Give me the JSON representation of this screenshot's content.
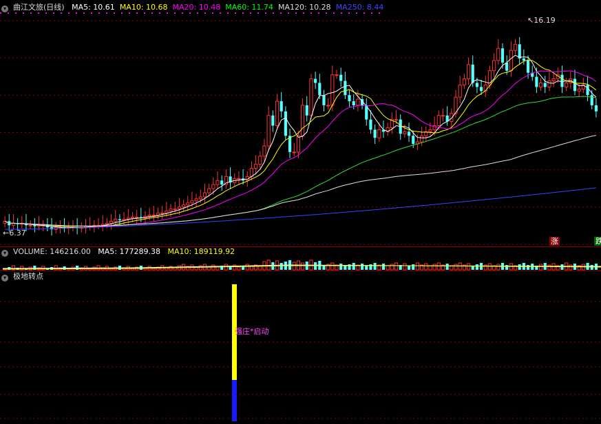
{
  "main": {
    "title": "曲江文旅(日线)",
    "ma": [
      {
        "label": "MA5: 10.61",
        "color": "#ffffff"
      },
      {
        "label": "MA10: 10.68",
        "color": "#ffff00"
      },
      {
        "label": "MA20: 10.48",
        "color": "#ff00ff"
      },
      {
        "label": "MA60: 11.74",
        "color": "#00ff00"
      },
      {
        "label": "MA120: 10.28",
        "color": "#dddddd"
      },
      {
        "label": "MA250: 8.44",
        "color": "#4444ff"
      }
    ],
    "high_label": "16.19",
    "low_label": "6.37",
    "tag_rise": "涨",
    "tag_fall": "跌"
  },
  "volume": {
    "title": "VOLUME: 146216.00",
    "ma5": "MA5: 177289.38",
    "ma10": "MA10: 189119.92"
  },
  "indicator": {
    "title": "极地转点",
    "signal_text": "强庄*启动"
  },
  "colors": {
    "up": "#ff3232",
    "down": "#54ffff",
    "grid": "#8b0000"
  },
  "chart_data": {
    "type": "candlestick",
    "title": "曲江文旅(日线)",
    "price_range": [
      6.0,
      17.0
    ],
    "high": 16.19,
    "low": 6.37,
    "ma_lines": [
      {
        "name": "MA5",
        "value": 10.61
      },
      {
        "name": "MA10",
        "value": 10.68
      },
      {
        "name": "MA20",
        "value": 10.48
      },
      {
        "name": "MA60",
        "value": 11.74
      },
      {
        "name": "MA120",
        "value": 10.28
      },
      {
        "name": "MA250",
        "value": 8.44
      }
    ],
    "closes": [
      6.8,
      6.6,
      6.7,
      6.65,
      6.7,
      6.6,
      6.6,
      6.55,
      6.6,
      6.6,
      6.5,
      6.4,
      6.5,
      6.5,
      6.45,
      6.5,
      6.5,
      6.45,
      6.5,
      6.55,
      6.55,
      6.6,
      6.6,
      6.65,
      6.7,
      6.8,
      6.9,
      6.85,
      6.9,
      6.95,
      7.0,
      7.0,
      6.95,
      7.05,
      7.1,
      7.1,
      7.2,
      7.2,
      7.3,
      7.4,
      7.4,
      7.5,
      7.6,
      7.7,
      7.8,
      7.9,
      8.0,
      8.2,
      8.4,
      8.6,
      8.8,
      8.6,
      9.0,
      8.7,
      8.9,
      8.9,
      8.8,
      9.0,
      9.4,
      9.6,
      10.0,
      10.5,
      12.0,
      11.5,
      12.7,
      12.2,
      11.0,
      10.2,
      10.2,
      11.0,
      12.5,
      12.0,
      13.8,
      13.6,
      13.0,
      12.5,
      12.5,
      14.0,
      14.0,
      13.7,
      13.0,
      12.7,
      12.5,
      12.8,
      12.5,
      11.8,
      11.3,
      10.9,
      11.3,
      11.2,
      11.4,
      11.8,
      11.8,
      11.1,
      11.2,
      11.0,
      10.6,
      10.7,
      11.0,
      11.2,
      11.3,
      11.5,
      12.0,
      12.0,
      11.7,
      12.1,
      12.9,
      13.5,
      13.8,
      14.5,
      13.6,
      13.4,
      13.2,
      13.5,
      14.2,
      14.7,
      15.3,
      14.6,
      14.2,
      15.2,
      15.5,
      14.8,
      14.7,
      14.1,
      13.9,
      13.4,
      13.6,
      13.4,
      13.7,
      13.8,
      14.0,
      13.4,
      13.6,
      13.8,
      13.2,
      13.3,
      13.5,
      13.0,
      12.5,
      12.2
    ]
  }
}
